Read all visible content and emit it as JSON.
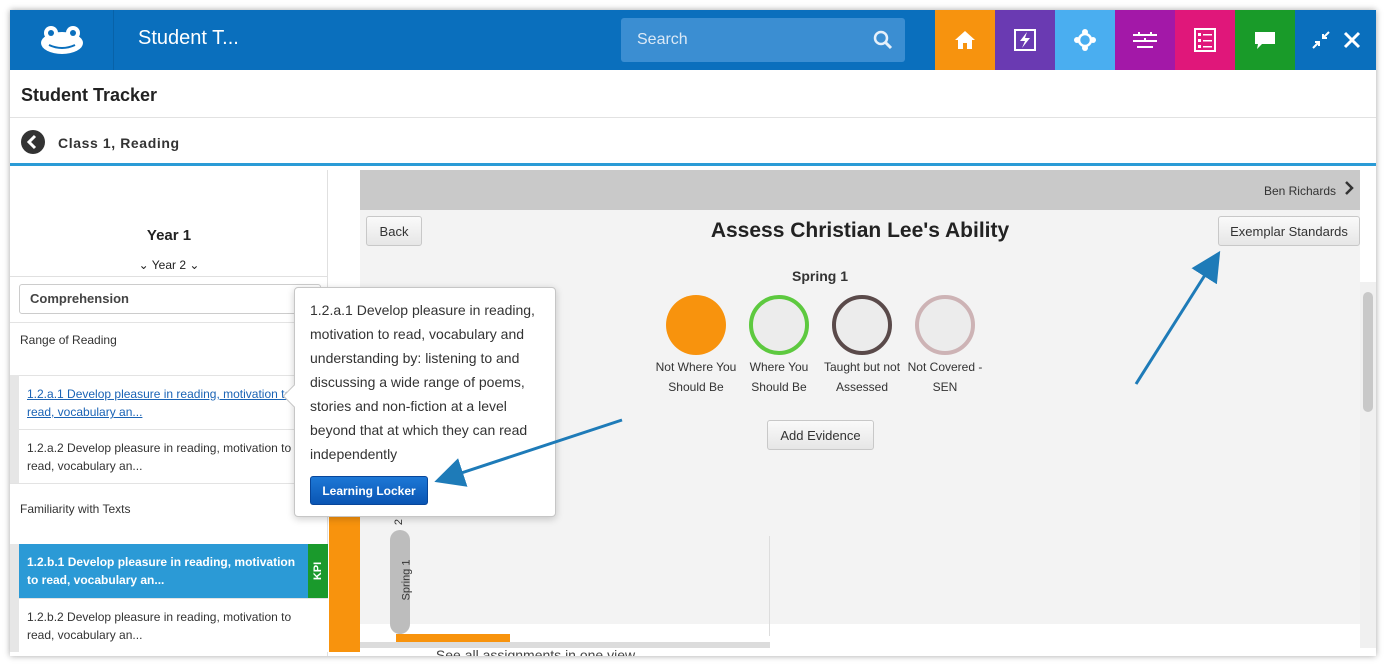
{
  "topbar": {
    "app_title": "Student T...",
    "search_placeholder": "Search",
    "tiles": [
      {
        "icon": "home-icon",
        "color": "#f7930e"
      },
      {
        "icon": "lightning-icon",
        "color": "#6a3ab2"
      },
      {
        "icon": "network-icon",
        "color": "#4aaef0"
      },
      {
        "icon": "keyboard-icon",
        "color": "#a318a8"
      },
      {
        "icon": "checklist-icon",
        "color": "#e0177a"
      },
      {
        "icon": "chat-icon",
        "color": "#199b29"
      }
    ]
  },
  "page": {
    "title": "Student Tracker",
    "breadcrumb": "Class 1, Reading"
  },
  "left": {
    "year": "Year 1",
    "year_next": "Year 2",
    "subject": "Comprehension",
    "groups": [
      {
        "label": "Range of Reading"
      },
      {
        "label": "Familiarity with Texts"
      }
    ],
    "objectives": [
      {
        "text": "1.2.a.1 Develop pleasure in reading, motivation to read, vocabulary an..."
      },
      {
        "text": "1.2.a.2 Develop pleasure in reading, motivation to read, vocabulary an..."
      },
      {
        "text": "1.2.b.1 Develop pleasure in reading, motivation to read, vocabulary an..."
      },
      {
        "text": "1.2.b.2 Develop pleasure in reading, motivation to read, vocabulary an..."
      }
    ],
    "kpi": "KPI"
  },
  "main": {
    "student": "Ben Richards",
    "back": "Back",
    "title": "Assess Christian Lee's Ability",
    "exemplar": "Exemplar Standards",
    "term": "Spring 1",
    "levels": [
      {
        "label": "Not Where You Should Be",
        "color": "#f8930d",
        "filled": true
      },
      {
        "label": "Where You Should Be",
        "color": "#5dc93f",
        "filled": false
      },
      {
        "label": "Taught but not Assessed",
        "color": "#5a4a4a",
        "filled": false
      },
      {
        "label": "Not Covered - SEN",
        "color": "#cdb3b5",
        "filled": false
      }
    ],
    "add_evidence": "Add Evidence",
    "timeline_term": "Spring 1",
    "timeline_num": "2",
    "footer_link": "See all assignments in one view"
  },
  "popover": {
    "text": "1.2.a.1 Develop pleasure in reading, motivation to read, vocabulary and understanding by: listening to and discussing a wide range of poems, stories and non-fiction at a level beyond that at which they can read independently",
    "button": "Learning Locker"
  }
}
